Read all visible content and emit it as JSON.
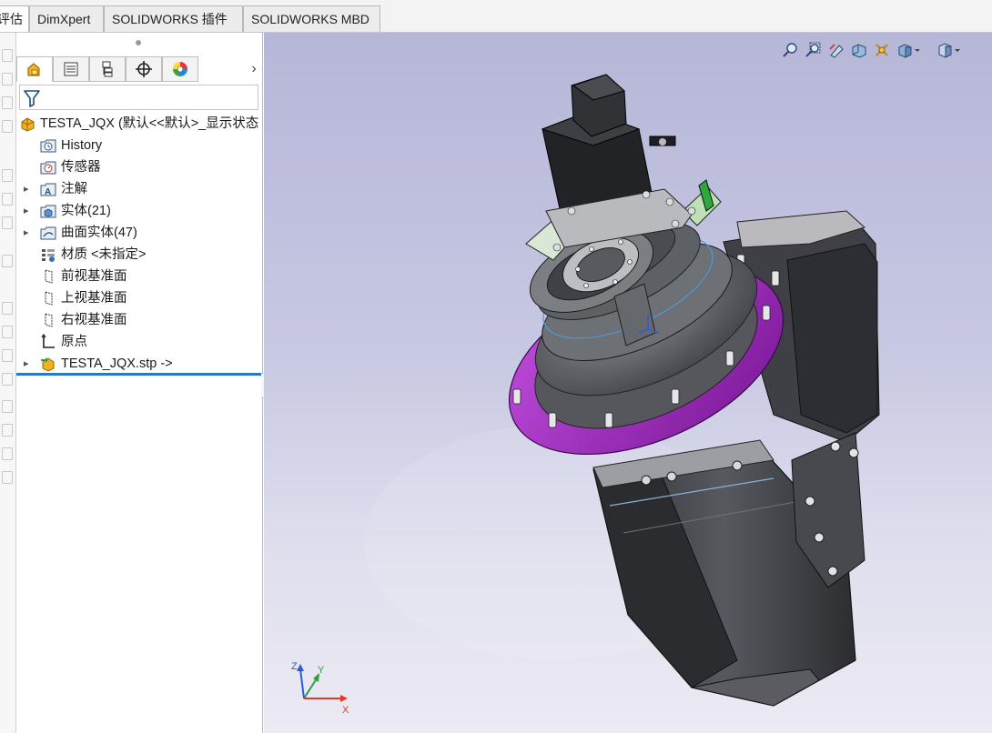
{
  "command_tabs": [
    {
      "label": "评估",
      "active": true
    },
    {
      "label": "DimXpert",
      "active": false
    },
    {
      "label": "SOLIDWORKS 插件",
      "active": false
    },
    {
      "label": "SOLIDWORKS MBD",
      "active": false
    }
  ],
  "feature_manager": {
    "tabs": [
      {
        "icon": "feature-manager-icon",
        "active": true
      },
      {
        "icon": "property-manager-icon",
        "active": false
      },
      {
        "icon": "configuration-manager-icon",
        "active": false
      },
      {
        "icon": "dimxpert-manager-icon",
        "active": false
      },
      {
        "icon": "display-manager-icon",
        "active": false
      }
    ],
    "more_glyph": "›",
    "filter_icon": "filter-icon",
    "tree": {
      "root": "TESTA_JQX  (默认<<默认>_显示状态",
      "items": [
        {
          "label": "History",
          "icon": "history-folder-icon",
          "expandable": false
        },
        {
          "label": "传感器",
          "icon": "sensors-folder-icon",
          "expandable": false
        },
        {
          "label": "注解",
          "icon": "annotations-folder-icon",
          "expandable": true
        },
        {
          "label": "实体(21)",
          "icon": "solid-bodies-folder-icon",
          "expandable": true
        },
        {
          "label": "曲面实体(47)",
          "icon": "surface-bodies-folder-icon",
          "expandable": true
        },
        {
          "label": "材质 <未指定>",
          "icon": "material-icon",
          "expandable": false
        },
        {
          "label": "前视基准面",
          "icon": "plane-icon",
          "expandable": false
        },
        {
          "label": "上视基准面",
          "icon": "plane-icon",
          "expandable": false
        },
        {
          "label": "右视基准面",
          "icon": "plane-icon",
          "expandable": false
        },
        {
          "label": "原点",
          "icon": "origin-icon",
          "expandable": false
        },
        {
          "label": "TESTA_JQX.stp ->",
          "icon": "imported-part-icon",
          "expandable": true
        }
      ]
    }
  },
  "heads_up_toolbar": [
    {
      "icon": "zoom-to-fit-icon"
    },
    {
      "icon": "zoom-to-area-icon"
    },
    {
      "icon": "previous-view-icon"
    },
    {
      "icon": "section-view-icon"
    },
    {
      "icon": "dynamic-annotation-icon"
    },
    {
      "icon": "view-orientation-icon"
    },
    {
      "icon": "display-style-icon"
    }
  ],
  "triad": {
    "x": "X",
    "y": "Y",
    "z": "Z"
  },
  "colors": {
    "accent_purple": "#a326c8",
    "body_dark": "#3d3f44",
    "selection_blue": "#2c78c2",
    "viewport_top": "#b6b7d8"
  }
}
